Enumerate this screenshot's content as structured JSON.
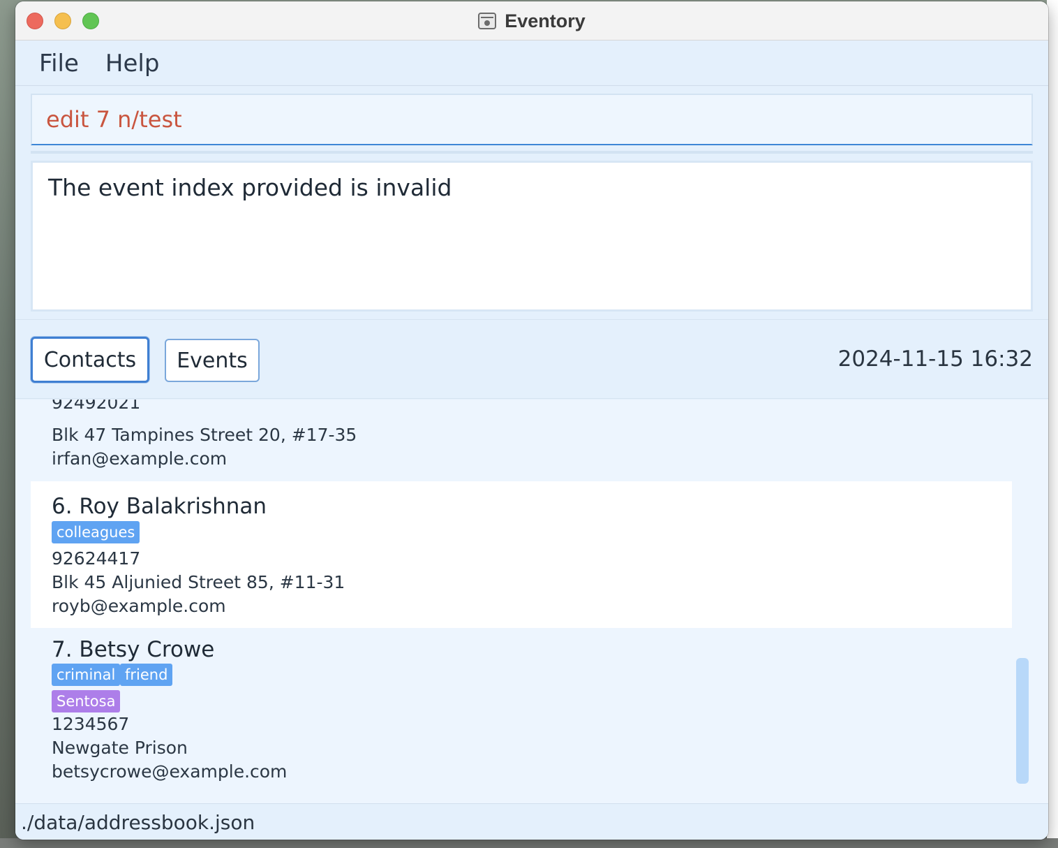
{
  "window": {
    "title": "Eventory"
  },
  "menu": {
    "file": "File",
    "help": "Help"
  },
  "command": {
    "value": "edit 7 n/test"
  },
  "result": {
    "message": "The event index provided is invalid"
  },
  "tabs": {
    "contacts": "Contacts",
    "events": "Events",
    "active": "Contacts"
  },
  "datetime": "2024-11-15 16:32",
  "contacts": [
    {
      "index_name": "",
      "tags": [],
      "location_tags": [],
      "phone": "92492021",
      "address": "Blk 47 Tampines Street 20, #17-35",
      "email": "irfan@example.com"
    },
    {
      "index_name": "6. Roy Balakrishnan",
      "tags": [
        "colleagues"
      ],
      "location_tags": [],
      "phone": "92624417",
      "address": "Blk 45 Aljunied Street 85, #11-31",
      "email": "royb@example.com"
    },
    {
      "index_name": "7. Betsy Crowe",
      "tags": [
        "criminal",
        "friend"
      ],
      "location_tags": [
        "Sentosa"
      ],
      "phone": "1234567",
      "address": "Newgate Prison",
      "email": "betsycrowe@example.com"
    }
  ],
  "status": {
    "file_path": "./data/addressbook.json"
  },
  "colors": {
    "accent": "#3f7fd2",
    "command_text": "#c9553f",
    "tag_blue": "#5fa3f2",
    "tag_purple": "#ad7ee9"
  }
}
